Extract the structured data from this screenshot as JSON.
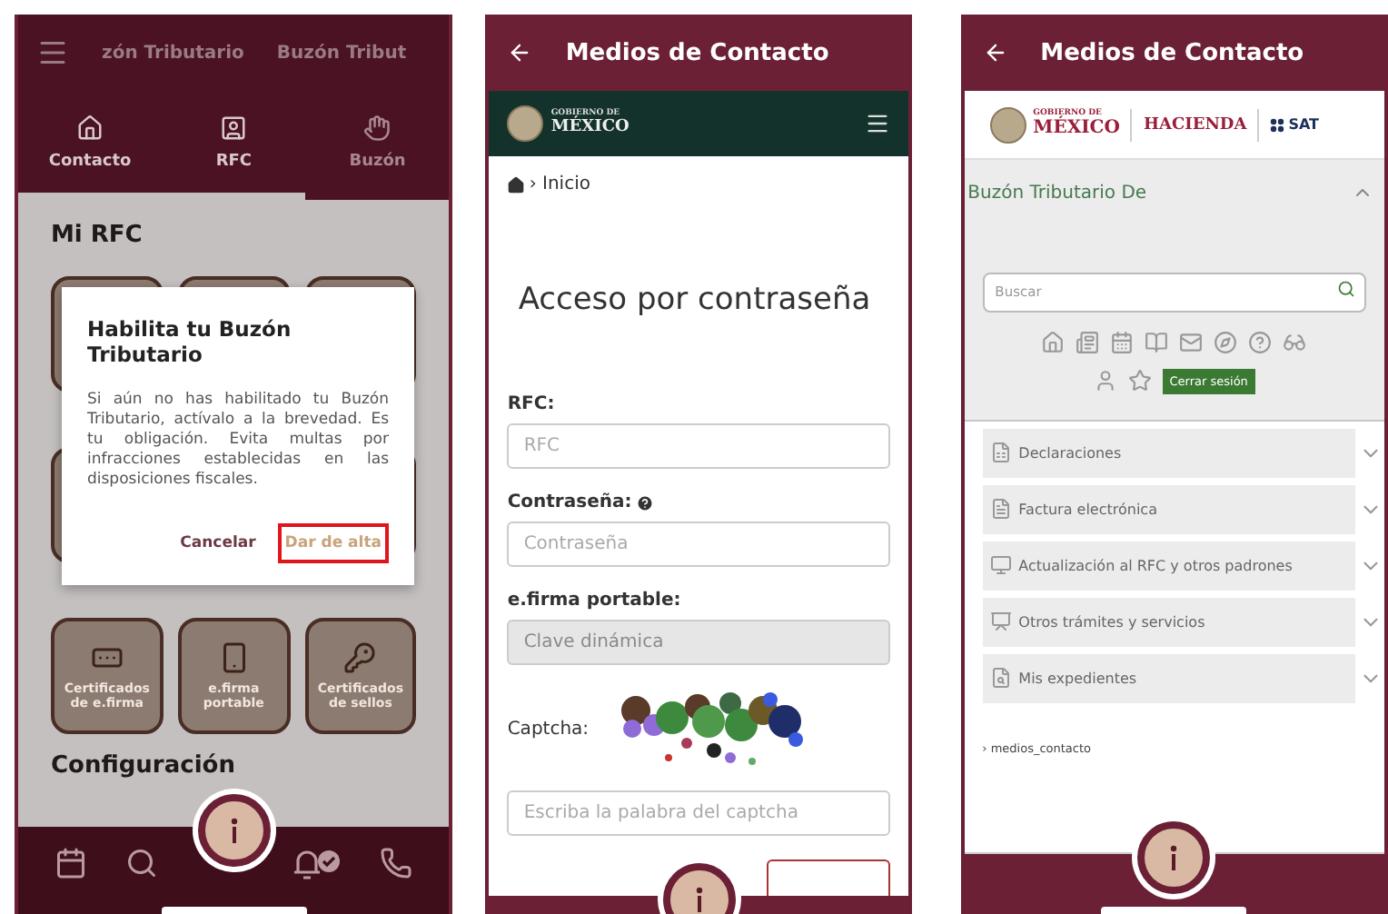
{
  "screens": [
    {
      "kind": "app",
      "header": {
        "titles": [
          "zón Tributario",
          "Buzón Tribut"
        ]
      },
      "tabs": [
        {
          "label": "Contacto",
          "selected": false
        },
        {
          "label": "RFC",
          "selected": false
        },
        {
          "label": "Buzón",
          "selected": true
        }
      ],
      "section_title": "Mi RFC",
      "cards": [
        {
          "label": "Certificados de e.firma"
        },
        {
          "label": "e.firma portable"
        },
        {
          "label": "Certificados de sellos"
        }
      ],
      "config_title": "Configuración",
      "dialog": {
        "title": "Habilita tu Buzón Tributario",
        "body": "Si aún no has habilitado tu Buzón Tributario, actívalo a la brevedad. Es tu obligación. Evita multas por infracciones establecidas en las disposiciones fiscales.",
        "buttons": [
          {
            "label": "Cancelar",
            "highlighted": false
          },
          {
            "label": "Dar de alta",
            "highlighted": true
          }
        ]
      }
    },
    {
      "kind": "login",
      "header": {
        "title": "Medios de Contacto"
      },
      "brand": {
        "line_1": "GOBIERNO DE",
        "line_2": "MÉXICO"
      },
      "breadcrumb": "› Inicio",
      "heading": "Acceso por contraseña",
      "fields": [
        {
          "kind": "text",
          "label": "RFC:",
          "placeholder": "RFC",
          "help": false,
          "disabled": false
        },
        {
          "kind": "text",
          "label": "Contraseña:",
          "placeholder": "Contraseña",
          "help": true,
          "disabled": false
        },
        {
          "kind": "text",
          "label": "e.firma portable:",
          "placeholder": "Clave dinámica",
          "help": false,
          "disabled": true
        },
        {
          "kind": "captcha",
          "label": "Captcha:"
        },
        {
          "kind": "text",
          "placeholder": "Escriba la palabra del captcha",
          "disabled": false
        }
      ]
    },
    {
      "kind": "portal",
      "header": {
        "title": "Medios de Contacto"
      },
      "brand": {
        "line_1": "GOBIERNO DE",
        "line_2": "MÉXICO",
        "agency": "HACIENDA",
        "sat": "SAT"
      },
      "panel": {
        "title": "Buzón Tributario De",
        "expanded": true
      },
      "search": {
        "placeholder": "Buscar"
      },
      "logout": "Cerrar sesión",
      "menu": [
        {
          "label": "Declaraciones",
          "expanded": false
        },
        {
          "label": "Factura electrónica",
          "expanded": false
        },
        {
          "label": "Actualización al RFC y otros padrones",
          "expanded": false
        },
        {
          "label": "Otros trámites y servicios",
          "expanded": false
        },
        {
          "label": "Mis expedientes",
          "expanded": false
        }
      ],
      "breadcrumb": "› medios_contacto"
    }
  ]
}
